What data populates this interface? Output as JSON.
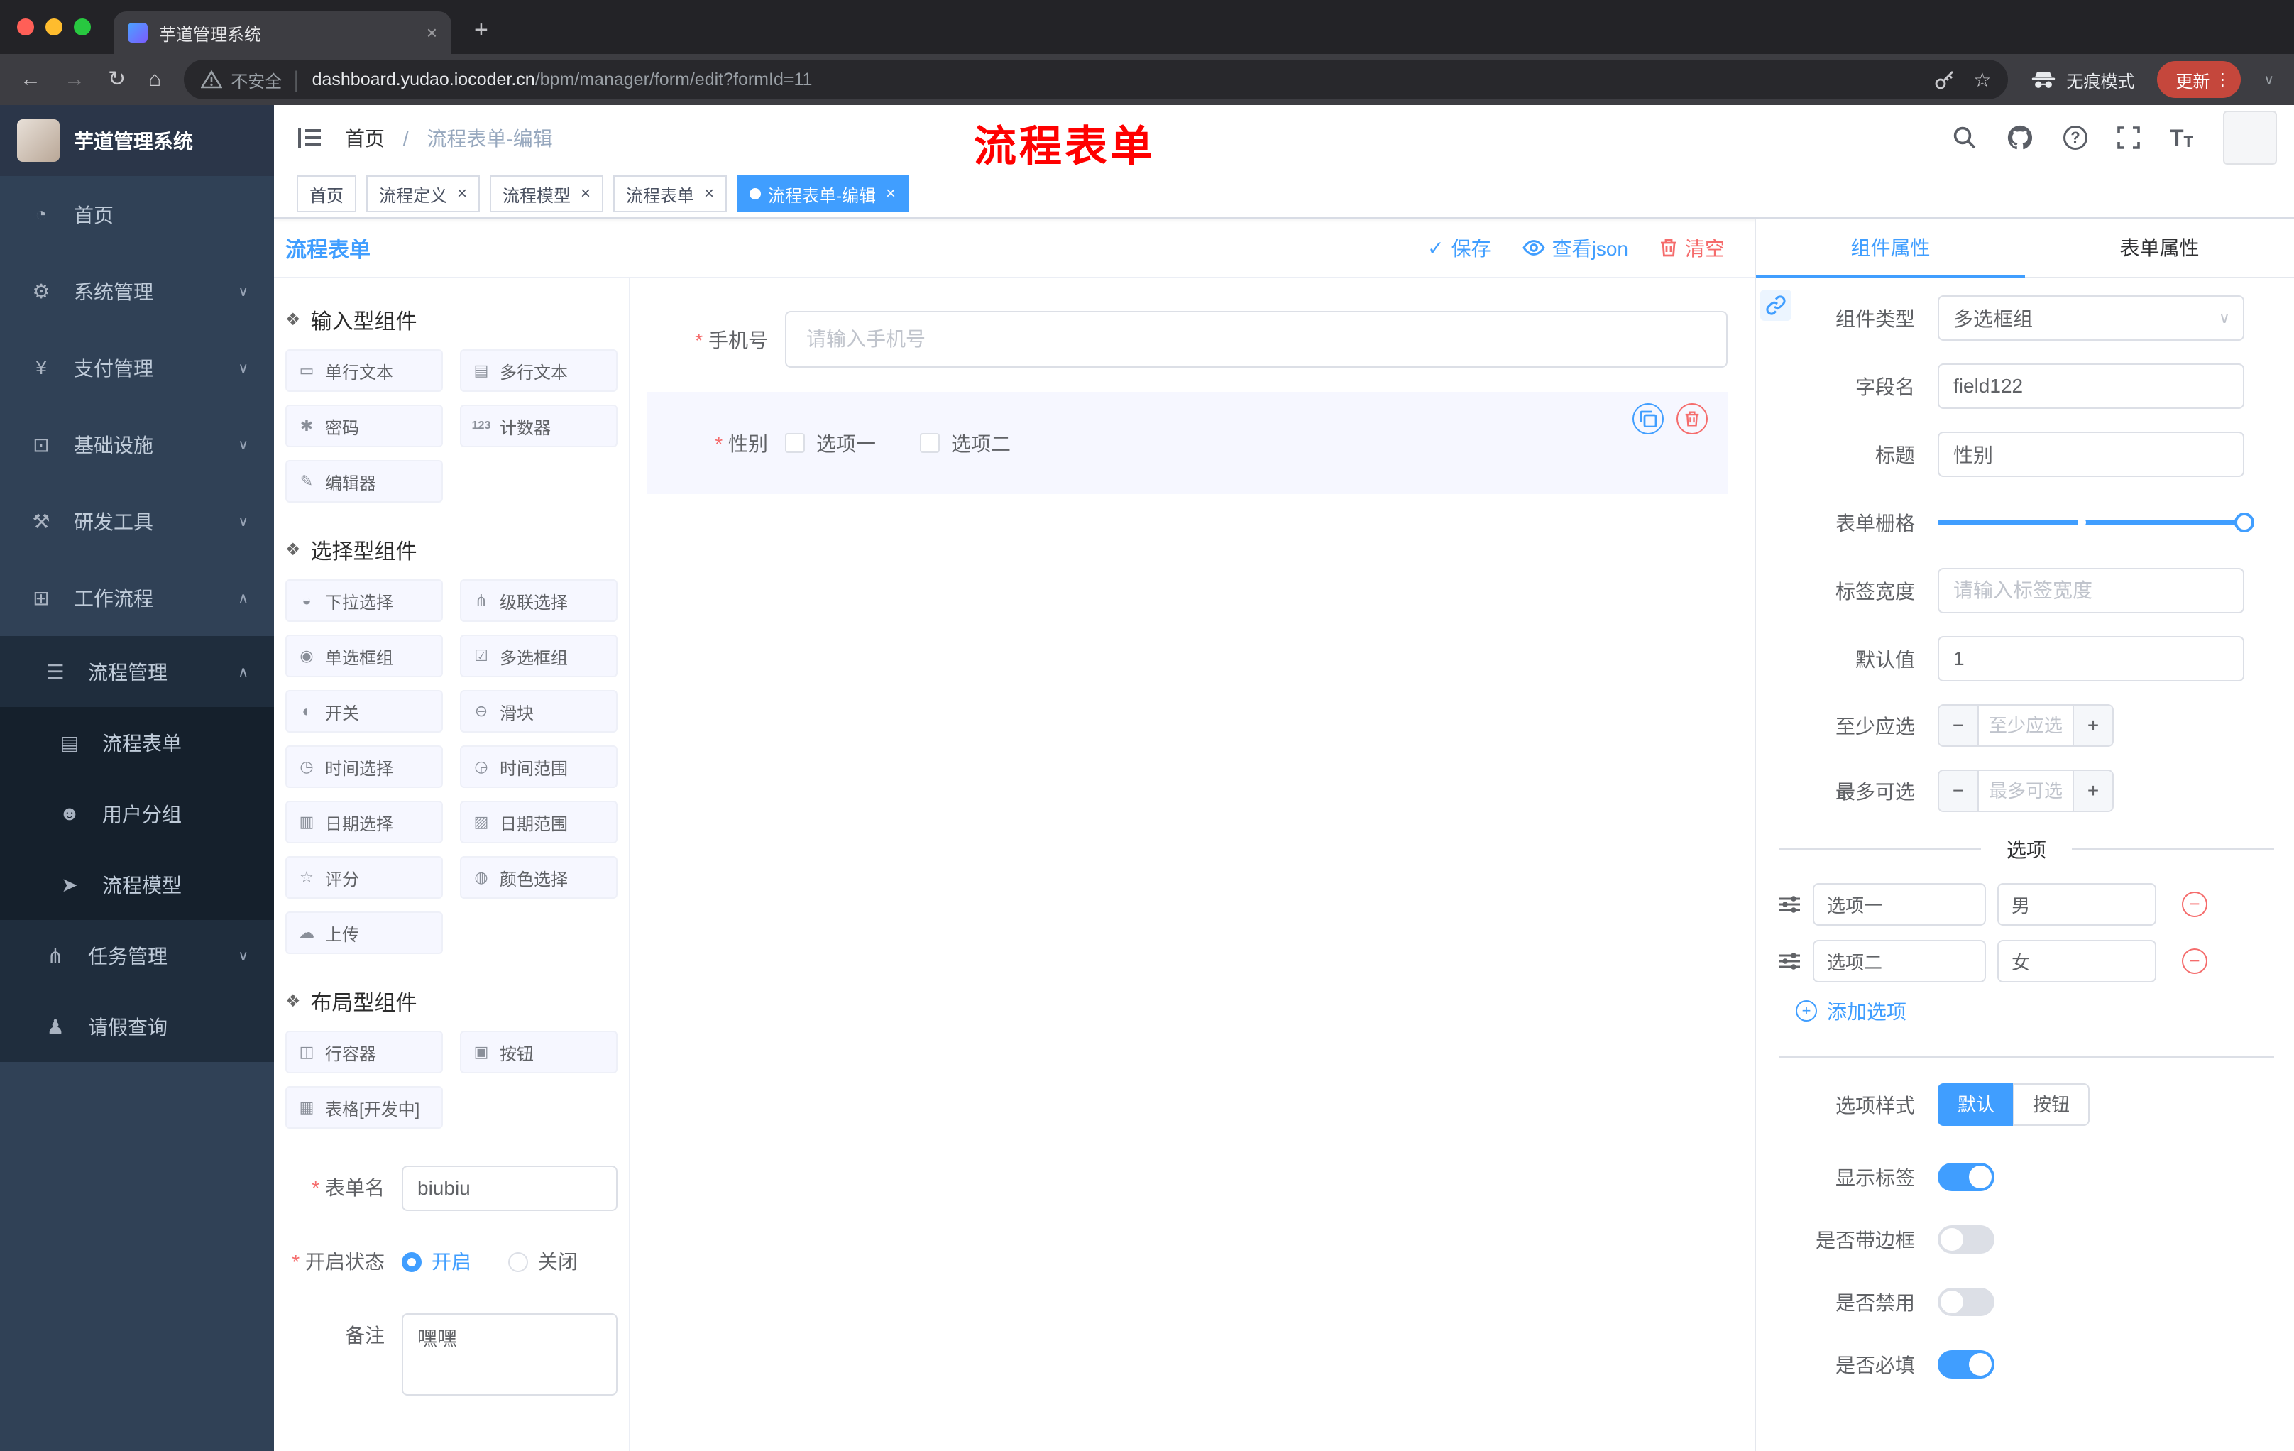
{
  "glyphs": {
    "close": "×",
    "plus": "+",
    "more": "⋮",
    "chevron_down": "∨",
    "chevron_up": "∧",
    "back": "←",
    "forward": "→",
    "reload": "↻",
    "home": "⌂",
    "star": "☆",
    "check": "✓",
    "minus": "−",
    "question": "?",
    "tsize_big": "T",
    "tsize_small": "T",
    "slash": "/"
  },
  "colors": {
    "accent": "#409eff",
    "danger": "#f56c6c",
    "sidebar_bg": "#304156",
    "annotation": "#ff0000",
    "update_chip": "#c5473c",
    "selected_widget_bg": "#f6f7ff"
  },
  "browser": {
    "tab_title": "芋道管理系统",
    "security_label": "不安全",
    "url_host": "dashboard.yudao.iocoder.cn",
    "url_path": "/bpm/manager/form/edit?formId=11",
    "incognito_label": "无痕模式",
    "update_label": "更新"
  },
  "annotation": {
    "text": "流程表单"
  },
  "sidebar": {
    "logo_title": "芋道管理系统",
    "menu": [
      {
        "label": "首页",
        "icon": "◔",
        "arrow": ""
      },
      {
        "label": "系统管理",
        "icon": "⚙",
        "arrow": "∨"
      },
      {
        "label": "支付管理",
        "icon": "¥",
        "arrow": "∨"
      },
      {
        "label": "基础设施",
        "icon": "⊡",
        "arrow": "∨"
      },
      {
        "label": "研发工具",
        "icon": "⚒",
        "arrow": "∨"
      },
      {
        "label": "工作流程",
        "icon": "⊞",
        "arrow": "∧"
      }
    ],
    "process_mgmt": {
      "label": "流程管理",
      "icon": "☰",
      "arrow": "∧"
    },
    "process_children": [
      {
        "label": "流程表单",
        "icon": "▤"
      },
      {
        "label": "用户分组",
        "icon": "☻"
      },
      {
        "label": "流程模型",
        "icon": "➤"
      }
    ],
    "task_mgmt": {
      "label": "任务管理",
      "icon": "⋔",
      "arrow": "∨"
    },
    "leave_query": {
      "label": "请假查询",
      "icon": "♟"
    }
  },
  "navbar": {
    "breadcrumb_home": "首页",
    "breadcrumb_sep": "/",
    "breadcrumb_current": "流程表单-编辑"
  },
  "tags": [
    {
      "label": "首页"
    },
    {
      "label": "流程定义",
      "close": "×"
    },
    {
      "label": "流程模型",
      "close": "×"
    },
    {
      "label": "流程表单",
      "close": "×"
    },
    {
      "label": "流程表单-编辑",
      "close": "×"
    }
  ],
  "editor": {
    "title": "流程表单",
    "save": "保存",
    "view_json": "查看json",
    "clear": "清空",
    "sections": [
      {
        "title": "输入型组件",
        "icon": "❖",
        "items": [
          {
            "icon": "▭",
            "label": "单行文本"
          },
          {
            "icon": "▤",
            "label": "多行文本"
          },
          {
            "icon": "✱",
            "label": "密码"
          },
          {
            "icon": "123",
            "label": "计数器"
          },
          {
            "icon": "✎",
            "label": "编辑器"
          }
        ]
      },
      {
        "title": "选择型组件",
        "icon": "❖",
        "items": [
          {
            "icon": "◒",
            "label": "下拉选择"
          },
          {
            "icon": "⋔",
            "label": "级联选择"
          },
          {
            "icon": "◉",
            "label": "单选框组"
          },
          {
            "icon": "☑",
            "label": "多选框组"
          },
          {
            "icon": "◐",
            "label": "开关"
          },
          {
            "icon": "⊖",
            "label": "滑块"
          },
          {
            "icon": "◷",
            "label": "时间选择"
          },
          {
            "icon": "◶",
            "label": "时间范围"
          },
          {
            "icon": "▥",
            "label": "日期选择"
          },
          {
            "icon": "▨",
            "label": "日期范围"
          },
          {
            "icon": "☆",
            "label": "评分"
          },
          {
            "icon": "◍",
            "label": "颜色选择"
          },
          {
            "icon": "☁",
            "label": "上传"
          }
        ]
      },
      {
        "title": "布局型组件",
        "icon": "❖",
        "items": [
          {
            "icon": "◫",
            "label": "行容器"
          },
          {
            "icon": "▣",
            "label": "按钮"
          },
          {
            "icon": "▦",
            "label": "表格[开发中]"
          }
        ]
      }
    ],
    "meta": {
      "form_name_label": "表单名",
      "form_name_value": "biubiu",
      "status_label": "开启状态",
      "status_on": "开启",
      "status_off": "关闭",
      "remark_label": "备注",
      "remark_value": "嘿嘿"
    },
    "canvas": {
      "phone_label": "手机号",
      "phone_placeholder": "请输入手机号",
      "gender_label": "性别",
      "gender_options": [
        "选项一",
        "选项二"
      ]
    }
  },
  "props": {
    "tab_component": "组件属性",
    "tab_form": "表单属性",
    "component_type_label": "组件类型",
    "component_type_value": "多选框组",
    "field_name_label": "字段名",
    "field_name_value": "field122",
    "title_label": "标题",
    "title_value": "性别",
    "grid_label": "表单栅格",
    "label_width_label": "标签宽度",
    "label_width_placeholder": "请输入标签宽度",
    "default_label": "默认值",
    "default_value": "1",
    "min_label": "至少应选",
    "min_placeholder": "至少应选",
    "max_label": "最多可选",
    "max_placeholder": "最多可选",
    "options_divider": "选项",
    "options": [
      {
        "name": "选项一",
        "value": "男"
      },
      {
        "name": "选项二",
        "value": "女"
      }
    ],
    "add_option": "添加选项",
    "style_label": "选项样式",
    "style_default": "默认",
    "style_button": "按钮",
    "switch_rows": [
      {
        "label": "显示标签",
        "on": true
      },
      {
        "label": "是否带边框",
        "on": false
      },
      {
        "label": "是否禁用",
        "on": false
      },
      {
        "label": "是否必填",
        "on": true
      }
    ]
  }
}
